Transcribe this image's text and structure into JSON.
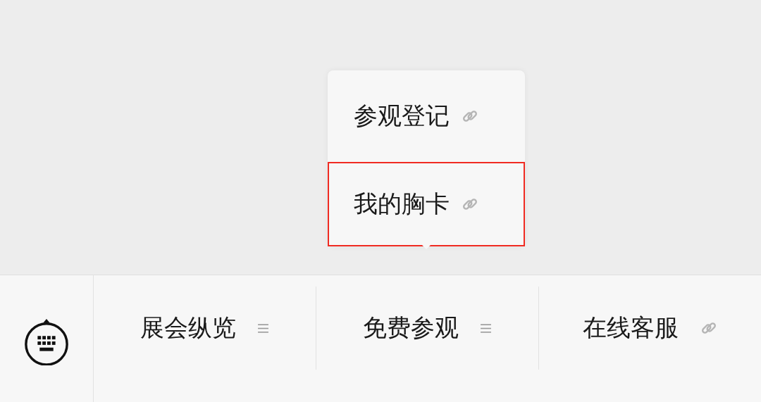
{
  "bottom_menu": {
    "items": [
      {
        "label": "展会纵览",
        "kind": "submenu"
      },
      {
        "label": "免费参观",
        "kind": "submenu",
        "children": [
          {
            "label": "参观登记",
            "kind": "link",
            "highlighted": false
          },
          {
            "label": "我的胸卡",
            "kind": "link",
            "highlighted": true
          }
        ]
      },
      {
        "label": "在线客服",
        "kind": "link"
      }
    ]
  }
}
